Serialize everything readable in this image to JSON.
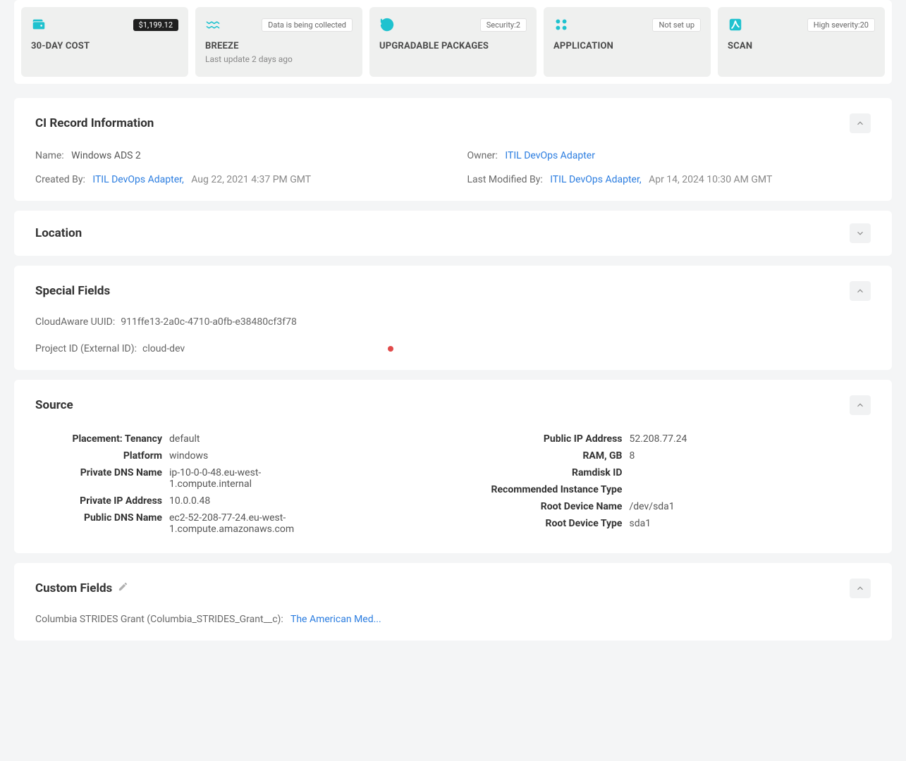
{
  "cards": {
    "cost": {
      "title": "30-DAY COST",
      "badge": "$1,199.12"
    },
    "breeze": {
      "title": "BREEZE",
      "badge": "Data is being collected",
      "sub": "Last update 2 days ago"
    },
    "upgradable": {
      "title": "UPGRADABLE PACKAGES",
      "badge": "Security:2"
    },
    "application": {
      "title": "APPLICATION",
      "badge": "Not set up"
    },
    "scan": {
      "title": "SCAN",
      "badge": "High severity:20"
    }
  },
  "ci": {
    "heading": "CI Record Information",
    "name_label": "Name:",
    "name_value": "Windows ADS 2",
    "owner_label": "Owner:",
    "owner_value": "ITIL DevOps Adapter",
    "created_by_label": "Created By:",
    "created_by_link": "ITIL DevOps Adapter,",
    "created_by_time": "Aug 22, 2021 4:37 PM GMT",
    "modified_by_label": "Last Modified By:",
    "modified_by_link": "ITIL DevOps Adapter,",
    "modified_by_time": "Apr 14, 2024 10:30 AM GMT"
  },
  "location": {
    "heading": "Location"
  },
  "special": {
    "heading": "Special Fields",
    "uuid_label": "CloudAware UUID:",
    "uuid_value": "911ffe13-2a0c-4710-a0fb-e38480cf3f78",
    "project_label": "Project ID (External ID):",
    "project_value": "cloud-dev"
  },
  "source": {
    "heading": "Source",
    "left": {
      "placement_tenancy_label": "Placement: Tenancy",
      "placement_tenancy_value": "default",
      "platform_label": "Platform",
      "platform_value": "windows",
      "private_dns_label": "Private DNS Name",
      "private_dns_value": "ip-10-0-0-48.eu-west-1.compute.internal",
      "private_ip_label": "Private IP Address",
      "private_ip_value": "10.0.0.48",
      "public_dns_label": "Public DNS Name",
      "public_dns_value": "ec2-52-208-77-24.eu-west-1.compute.amazonaws.com"
    },
    "right": {
      "public_ip_label": "Public IP Address",
      "public_ip_value": "52.208.77.24",
      "ram_label": "RAM, GB",
      "ram_value": "8",
      "ramdisk_label": "Ramdisk ID",
      "ramdisk_value": "",
      "recommended_label": "Recommended Instance Type",
      "recommended_value": "",
      "root_name_label": "Root Device Name",
      "root_name_value": "/dev/sda1",
      "root_type_label": "Root Device Type",
      "root_type_value": "sda1"
    }
  },
  "custom": {
    "heading": "Custom Fields",
    "grant_label": "Columbia STRIDES Grant (Columbia_STRIDES_Grant__c):",
    "grant_value": "The American Med..."
  }
}
